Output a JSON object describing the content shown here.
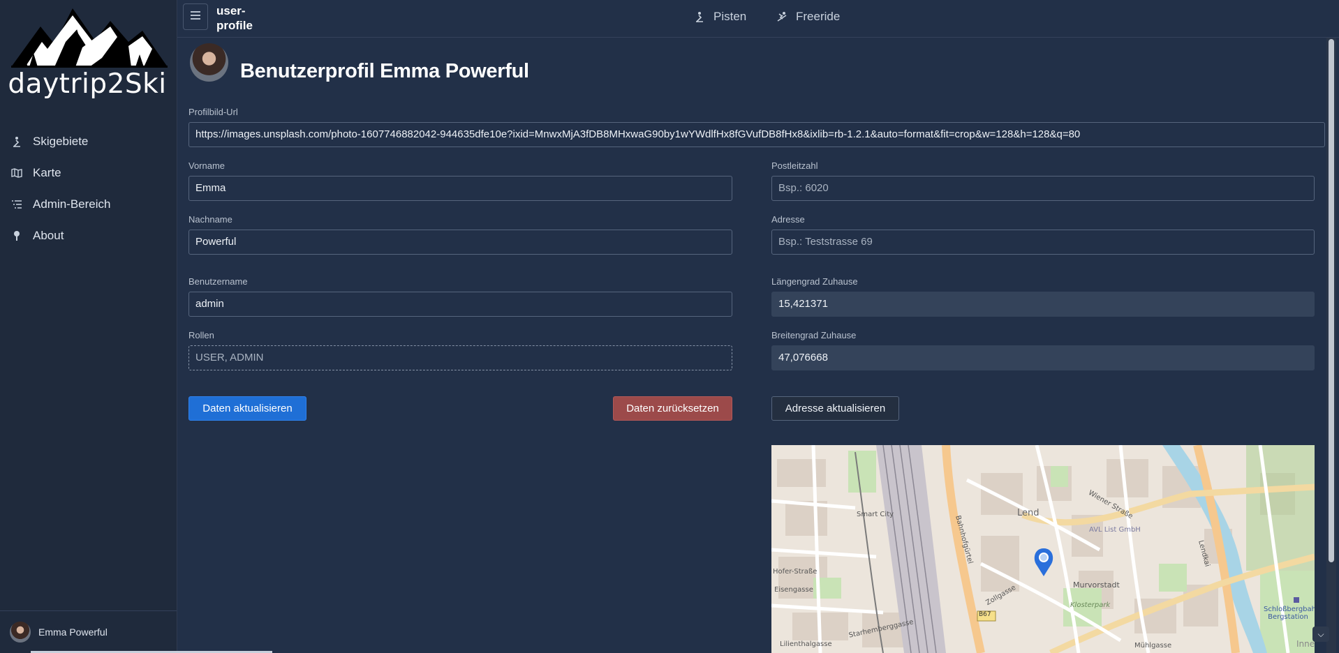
{
  "app": {
    "brand": "daytrip2Ski",
    "page_crumb": "user-profile"
  },
  "sidebar": {
    "items": [
      {
        "label": "Skigebiete",
        "icon": "skier-icon"
      },
      {
        "label": "Karte",
        "icon": "map-icon"
      },
      {
        "label": "Admin-Bereich",
        "icon": "list-icon"
      },
      {
        "label": "About",
        "icon": "pin-icon"
      }
    ],
    "user": {
      "name": "Emma Powerful"
    }
  },
  "topbar": {
    "links": [
      {
        "label": "Pisten",
        "icon": "skier-icon"
      },
      {
        "label": "Freeride",
        "icon": "freeride-icon"
      }
    ]
  },
  "profile": {
    "title": "Benutzerprofil Emma Powerful",
    "image_url_label": "Profilbild-Url",
    "image_url": "https://images.unsplash.com/photo-1607746882042-944635dfe10e?ixid=MnwxMjA3fDB8MHxwaG90by1wYWdlfHx8fGVufDB8fHx8&ixlib=rb-1.2.1&auto=format&fit=crop&w=128&h=128&q=80",
    "firstname_label": "Vorname",
    "firstname": "Emma",
    "lastname_label": "Nachname",
    "lastname": "Powerful",
    "username_label": "Benutzername",
    "username": "admin",
    "roles_label": "Rollen",
    "roles": "USER, ADMIN",
    "zip_label": "Postleitzahl",
    "zip_placeholder": "Bsp.: 6020",
    "address_label": "Adresse",
    "address_placeholder": "Bsp.: Teststrasse 69",
    "longitude_label": "Längengrad Zuhause",
    "longitude": "15,421371",
    "latitude_label": "Breitengrad Zuhause",
    "latitude": "47,076668"
  },
  "buttons": {
    "update": "Daten aktualisieren",
    "reset": "Daten zurücksetzen",
    "update_address": "Adresse aktualisieren"
  },
  "map": {
    "labels": [
      "Smart City",
      "Lend",
      "AVL List GmbH",
      "Murvorstadt",
      "Klosterpark",
      "Bahnhofgürtel",
      "Wiener Straße",
      "Lendkai",
      "Schloßbergbahn Bergstation",
      "B67",
      "Hofer-Straße",
      "Eisengasse",
      "Lilienthalgasse",
      "Starhemberggasse",
      "Mühlgasse",
      "Zollgasse",
      "Inne"
    ]
  }
}
